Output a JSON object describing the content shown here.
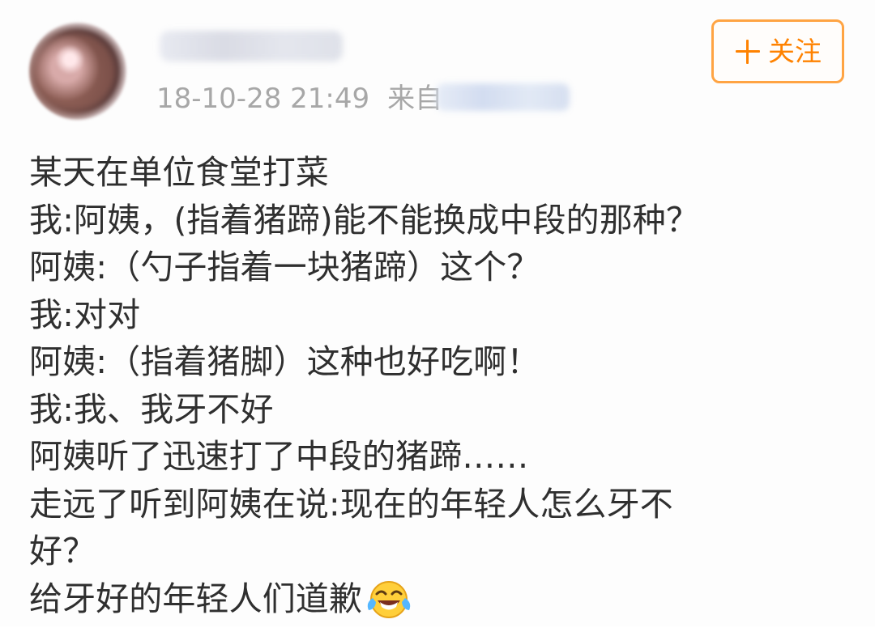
{
  "header": {
    "timestamp": "18-10-28 21:49",
    "from_label": "来自",
    "follow_label": "关注"
  },
  "post": {
    "lines": [
      "某天在单位食堂打菜",
      "我:阿姨，(指着猪蹄)能不能换成中段的那种？",
      "阿姨:（勺子指着一块猪蹄）这个？",
      "我:对对",
      "阿姨:（指着猪脚）这种也好吃啊！",
      "我:我、我牙不好",
      "阿姨听了迅速打了中段的猪蹄……",
      "走远了听到阿姨在说:现在的年轻人怎么牙不",
      "好？",
      "给牙好的年轻人们道歉"
    ],
    "emoji": "laughing-crying-face"
  },
  "icons": {
    "follow": "plus-icon",
    "emoji": "face-with-tears-of-joy-icon"
  },
  "colors": {
    "accent": "#ff8200",
    "button_border": "#ffa443",
    "meta_text": "#a7a7a7",
    "body_text": "#2f2f2f"
  }
}
